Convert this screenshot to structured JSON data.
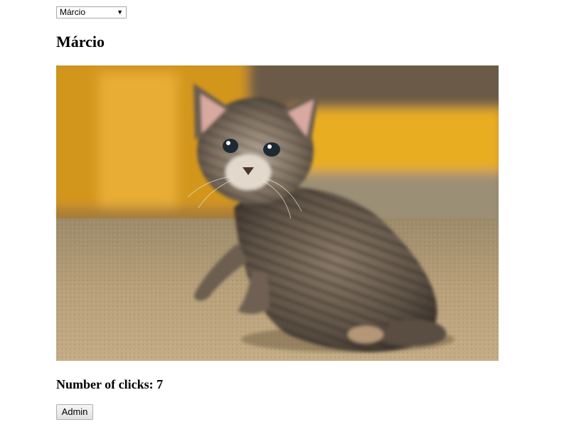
{
  "selector": {
    "selected": "Márcio"
  },
  "cat": {
    "name": "Márcio",
    "image_description": "kitten-photo",
    "clicks_label": "Number of clicks:",
    "clicks": "7"
  },
  "admin": {
    "button_label": "Admin"
  }
}
